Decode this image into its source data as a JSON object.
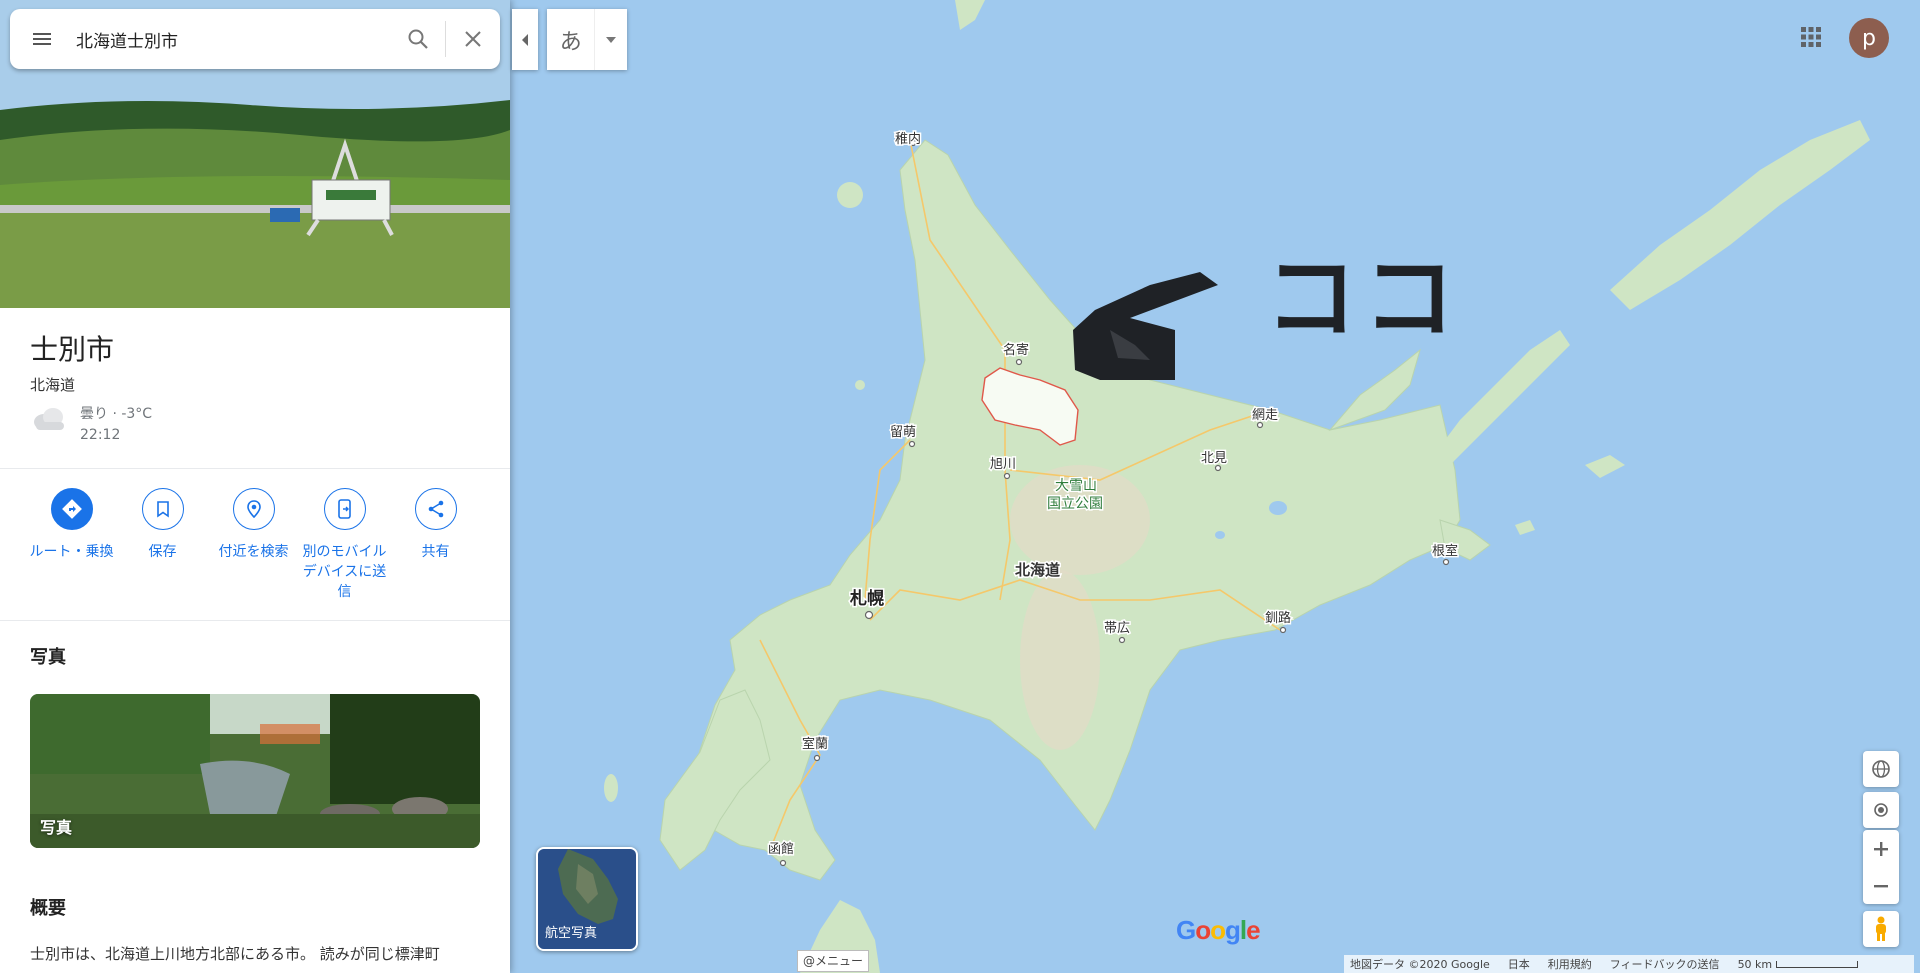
{
  "search": {
    "query": "北海道士別市"
  },
  "place": {
    "title": "士別市",
    "region": "北海道",
    "weather": {
      "condition": "曇り · -3°C",
      "time": "22:12",
      "icon": "cloud-icon"
    }
  },
  "actions": [
    {
      "label": "ルート・乗換",
      "icon": "directions-icon"
    },
    {
      "label": "保存",
      "icon": "bookmark-icon"
    },
    {
      "label": "付近を検索",
      "icon": "nearby-icon"
    },
    {
      "label": "別のモバイルデバイスに送信",
      "icon": "send-to-phone-icon"
    },
    {
      "label": "共有",
      "icon": "share-icon"
    }
  ],
  "photos": {
    "heading": "写真",
    "caption": "写真"
  },
  "overview": {
    "heading": "概要",
    "text": "士別市は、北海道上川地方北部にある市。 読みが同じ標津町"
  },
  "map": {
    "ime_char": "あ",
    "avatar_letter": "p",
    "annotation": "ココ",
    "labels": {
      "wakkanai": "稚内",
      "nayoro": "名寄",
      "rumoi": "留萌",
      "asahikawa": "旭川",
      "daisetsuzan": "大雪山",
      "national_park": "国立公園",
      "abashiri": "網走",
      "kitami": "北見",
      "nemuro": "根室",
      "hokkaido": "北海道",
      "sapporo": "札幌",
      "obihiro": "帯広",
      "kushiro": "釧路",
      "muroran": "室蘭",
      "hakodate": "函館"
    },
    "satellite_label": "航空写真",
    "menu_hint": "@メニュー",
    "footer": {
      "data": "地図データ ©2020 Google",
      "country": "日本",
      "terms": "利用規約",
      "feedback": "フィードバックの送信",
      "scale": "50 km"
    },
    "colors": {
      "water": "#9fc9ee",
      "land": "#cfe5c4",
      "accent": "#1a73e8",
      "boundary": "#e0584a"
    }
  }
}
